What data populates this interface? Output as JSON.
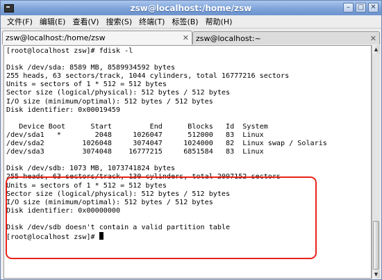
{
  "window": {
    "title": "zsw@localhost:/home/zsw",
    "minimize_glyph": "–",
    "maximize_glyph": "□",
    "close_glyph": "✕"
  },
  "menubar": {
    "items": [
      {
        "label": "文件(F)"
      },
      {
        "label": "编辑(E)"
      },
      {
        "label": "查看(V)"
      },
      {
        "label": "搜索(S)"
      },
      {
        "label": "终端(T)"
      },
      {
        "label": "标签(B)"
      },
      {
        "label": "帮助(H)"
      }
    ]
  },
  "tabs": [
    {
      "label": "zsw@localhost:/home/zsw",
      "close": "✕"
    },
    {
      "label": "zsw@localhost:~",
      "close": "✕"
    }
  ],
  "terminal": {
    "lines": [
      "[root@localhost zsw]# fdisk -l",
      "",
      "Disk /dev/sda: 8589 MB, 8589934592 bytes",
      "255 heads, 63 sectors/track, 1044 cylinders, total 16777216 sectors",
      "Units = sectors of 1 * 512 = 512 bytes",
      "Sector size (logical/physical): 512 bytes / 512 bytes",
      "I/O size (minimum/optimal): 512 bytes / 512 bytes",
      "Disk identifier: 0x00019459",
      "",
      "   Device Boot      Start         End      Blocks   Id  System",
      "/dev/sda1   *        2048     1026047      512000   83  Linux",
      "/dev/sda2         1026048     3074047     1024000   82  Linux swap / Solaris",
      "/dev/sda3         3074048    16777215     6851584   83  Linux",
      "",
      "Disk /dev/sdb: 1073 MB, 1073741824 bytes",
      "255 heads, 63 sectors/track, 130 cylinders, total 2097152 sectors",
      "Units = sectors of 1 * 512 = 512 bytes",
      "Sector size (logical/physical): 512 bytes / 512 bytes",
      "I/O size (minimum/optimal): 512 bytes / 512 bytes",
      "Disk identifier: 0x00000000",
      "",
      "Disk /dev/sdb doesn't contain a valid partition table"
    ],
    "prompt": "[root@localhost zsw]# "
  },
  "colors": {
    "highlight": "#e8231a",
    "titlebar": "#7fa3d8"
  }
}
